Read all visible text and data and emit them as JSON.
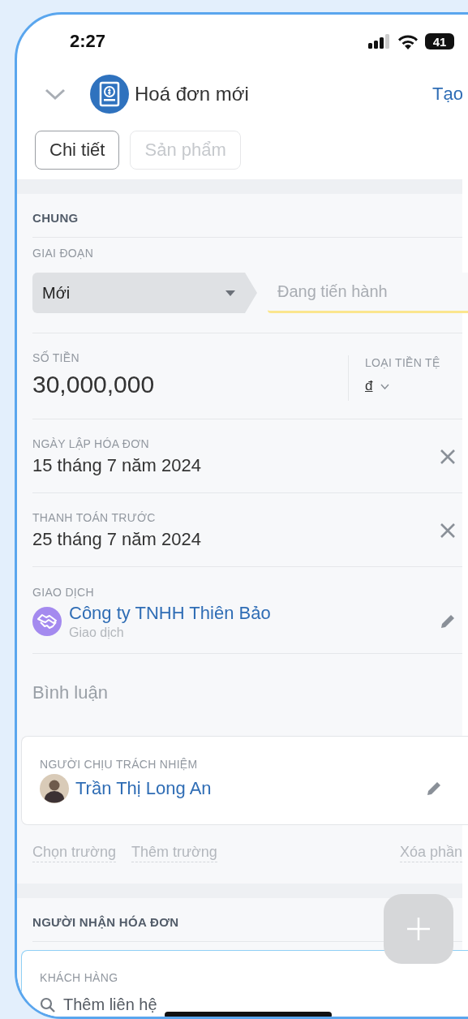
{
  "status_bar": {
    "time": "2:27",
    "battery": "41"
  },
  "header": {
    "title": "Hoá đơn mới",
    "action": "Tạo"
  },
  "tabs": [
    {
      "label": "Chi tiết",
      "selected": true
    },
    {
      "label": "Sản phẩm",
      "selected": false
    }
  ],
  "general": {
    "title": "CHUNG",
    "stage": {
      "label": "GIAI ĐOẠN",
      "steps": [
        {
          "label": "Mới",
          "selected": true
        },
        {
          "label": "Đang tiến hành",
          "selected": false
        }
      ]
    },
    "amount": {
      "label": "SỐ TIỀN",
      "value": "30,000,000"
    },
    "currency": {
      "label": "LOẠI TIỀN TỆ",
      "value": "đ"
    },
    "dates": [
      {
        "label": "NGÀY LẬP HÓA ĐƠN",
        "value": "15 tháng 7 năm 2024"
      },
      {
        "label": "THANH TOÁN TRƯỚC",
        "value": "25 tháng 7 năm 2024"
      }
    ],
    "deal": {
      "label": "GIAO DỊCH",
      "name": "Công ty TNHH Thiên Bảo",
      "type": "Giao dịch"
    },
    "comment": {
      "placeholder": "Bình luận"
    },
    "responsible": {
      "label": "NGƯỜI CHỊU TRÁCH NHIỆM",
      "name": "Trần Thị Long An"
    },
    "actions": [
      "Chọn trường",
      "Thêm trường",
      "Xóa phần"
    ]
  },
  "recipients": {
    "title": "NGƯỜI NHẬN HÓA ĐƠN",
    "customer": {
      "label": "KHÁCH HÀNG",
      "placeholder": "Thêm liên hệ"
    }
  }
}
